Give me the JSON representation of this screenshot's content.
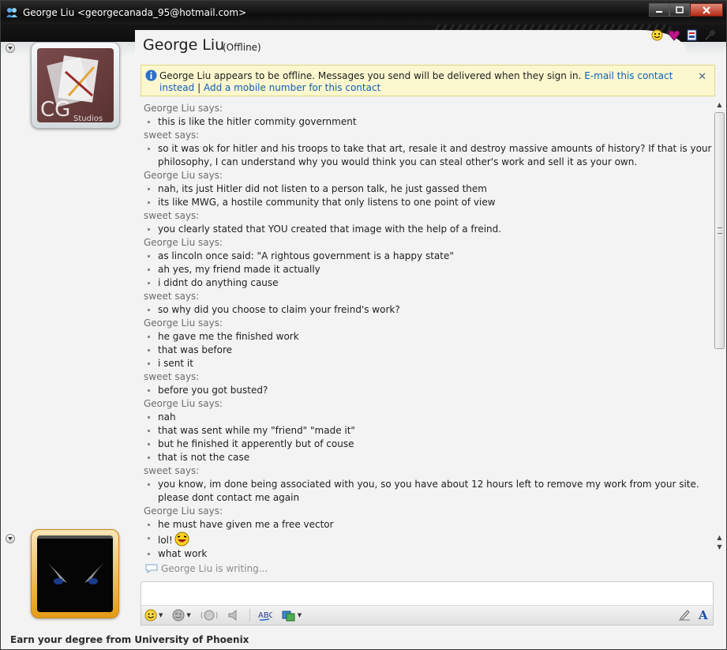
{
  "window": {
    "title": "George Liu <georgecanada_95@hotmail.com>"
  },
  "contact": {
    "name": "George Liu",
    "status": "(Offline)"
  },
  "contact_picture": {
    "logo_text": "CG",
    "logo_subtext": "Studios"
  },
  "infobar": {
    "message": "George Liu appears to be offline. Messages you send will be delivered when they sign in.",
    "link_email": "E-mail this contact instead",
    "separator": "|",
    "link_mobile": "Add a mobile number for this contact"
  },
  "conversation": [
    {
      "sender": "George Liu says:",
      "lines": [
        "this is like the hitler commity government"
      ]
    },
    {
      "sender": "sweet says:",
      "lines": [
        "so it was ok for hitler and his troops to take that art, resale it and destroy massive amounts of history? If that is your philosophy, I can understand why you would think you can steal other's work and sell it as your own."
      ]
    },
    {
      "sender": "George Liu says:",
      "lines": [
        "nah, its just Hitler did not listen to a person talk, he just gassed them",
        "its like MWG, a hostile community that only listens to one point of view"
      ]
    },
    {
      "sender": "sweet says:",
      "lines": [
        "you clearly stated that YOU created that image with the help of a freind."
      ]
    },
    {
      "sender": "George Liu says:",
      "lines": [
        "as lincoln once said: \"A rightous government is a happy state\"",
        "ah yes, my friend made it actually",
        "i didnt do anything cause"
      ]
    },
    {
      "sender": "sweet says:",
      "lines": [
        "so why did you choose to claim your freind's work?"
      ]
    },
    {
      "sender": "George Liu says:",
      "lines": [
        "he gave me the finished work",
        "that was before",
        "i sent it"
      ]
    },
    {
      "sender": "sweet says:",
      "lines": [
        "before you got busted?"
      ]
    },
    {
      "sender": "George Liu says:",
      "lines": [
        "nah",
        "that was sent while my \"friend\" \"made it\"",
        "but he finished it apperently but of couse",
        "that is not the case"
      ]
    },
    {
      "sender": "sweet says:",
      "lines": [
        "you know, im done being associated with you, so you have about 12 hours left to remove my work from your site. please dont contact me again"
      ]
    },
    {
      "sender": "George Liu says:",
      "lines": [
        "he must have given me a free vector",
        "lol!",
        "what work"
      ]
    }
  ],
  "typing_status": "George Liu is writing...",
  "input": {
    "value": ""
  },
  "toolbar_icons": [
    "emoticon-icon",
    "wink-icon",
    "nudge-icon",
    "voice-clip-icon",
    "spell-check-icon",
    "background-icon",
    "handwriting-icon",
    "font-icon"
  ],
  "footer_ad": "Earn your degree from University of Phoenix"
}
